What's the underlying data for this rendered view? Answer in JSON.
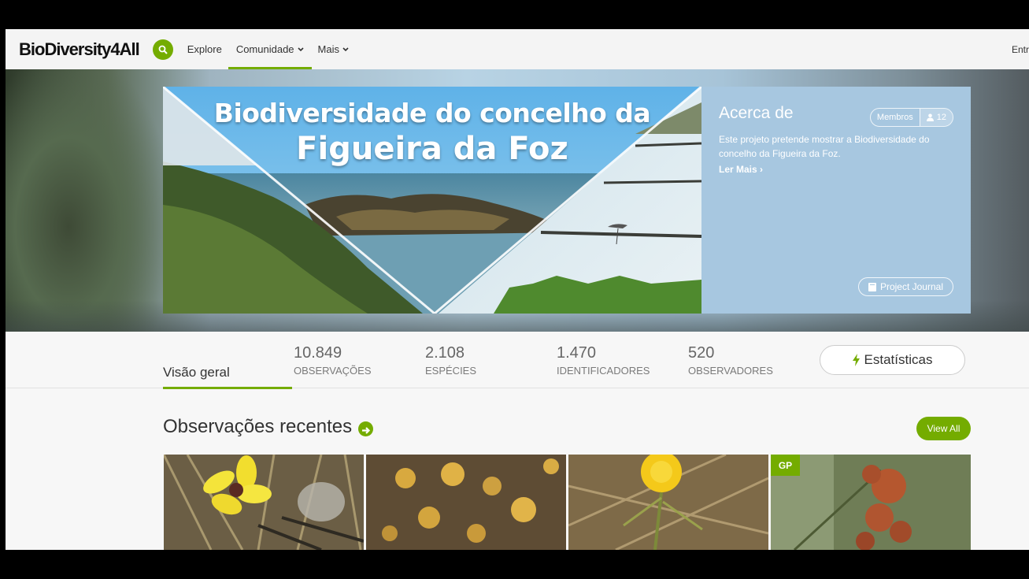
{
  "nav": {
    "logo": "BioDiversity4All",
    "items": [
      {
        "label": "Explore",
        "dropdown": false
      },
      {
        "label": "Comunidade",
        "dropdown": true,
        "active": true
      },
      {
        "label": "Mais",
        "dropdown": true
      }
    ],
    "right_label": "Entr"
  },
  "banner": {
    "title_line1": "Biodiversidade do concelho da",
    "title_line2": "Figueira da Foz"
  },
  "about": {
    "title": "Acerca de",
    "members_label": "Membros",
    "members_count": "12",
    "description": "Este projeto pretende mostrar a Biodiversidade do concelho da Figueira da Foz.",
    "read_more": "Ler Mais",
    "journal_label": "Project Journal"
  },
  "stats": {
    "overview_tab": "Visão geral",
    "items": [
      {
        "value": "10.849",
        "label": "Observações"
      },
      {
        "value": "2.108",
        "label": "Espécies"
      },
      {
        "value": "1.470",
        "label": "Identificadores"
      },
      {
        "value": "520",
        "label": "Observadores"
      }
    ],
    "button_label": "Estatísticas"
  },
  "recent": {
    "title": "Observações recentes",
    "view_all": "View All",
    "photos": [
      {
        "badge": ""
      },
      {
        "badge": ""
      },
      {
        "badge": ""
      },
      {
        "badge": "GP"
      }
    ]
  },
  "colors": {
    "accent": "#74ac00",
    "about_panel": "#a7c7e0"
  }
}
